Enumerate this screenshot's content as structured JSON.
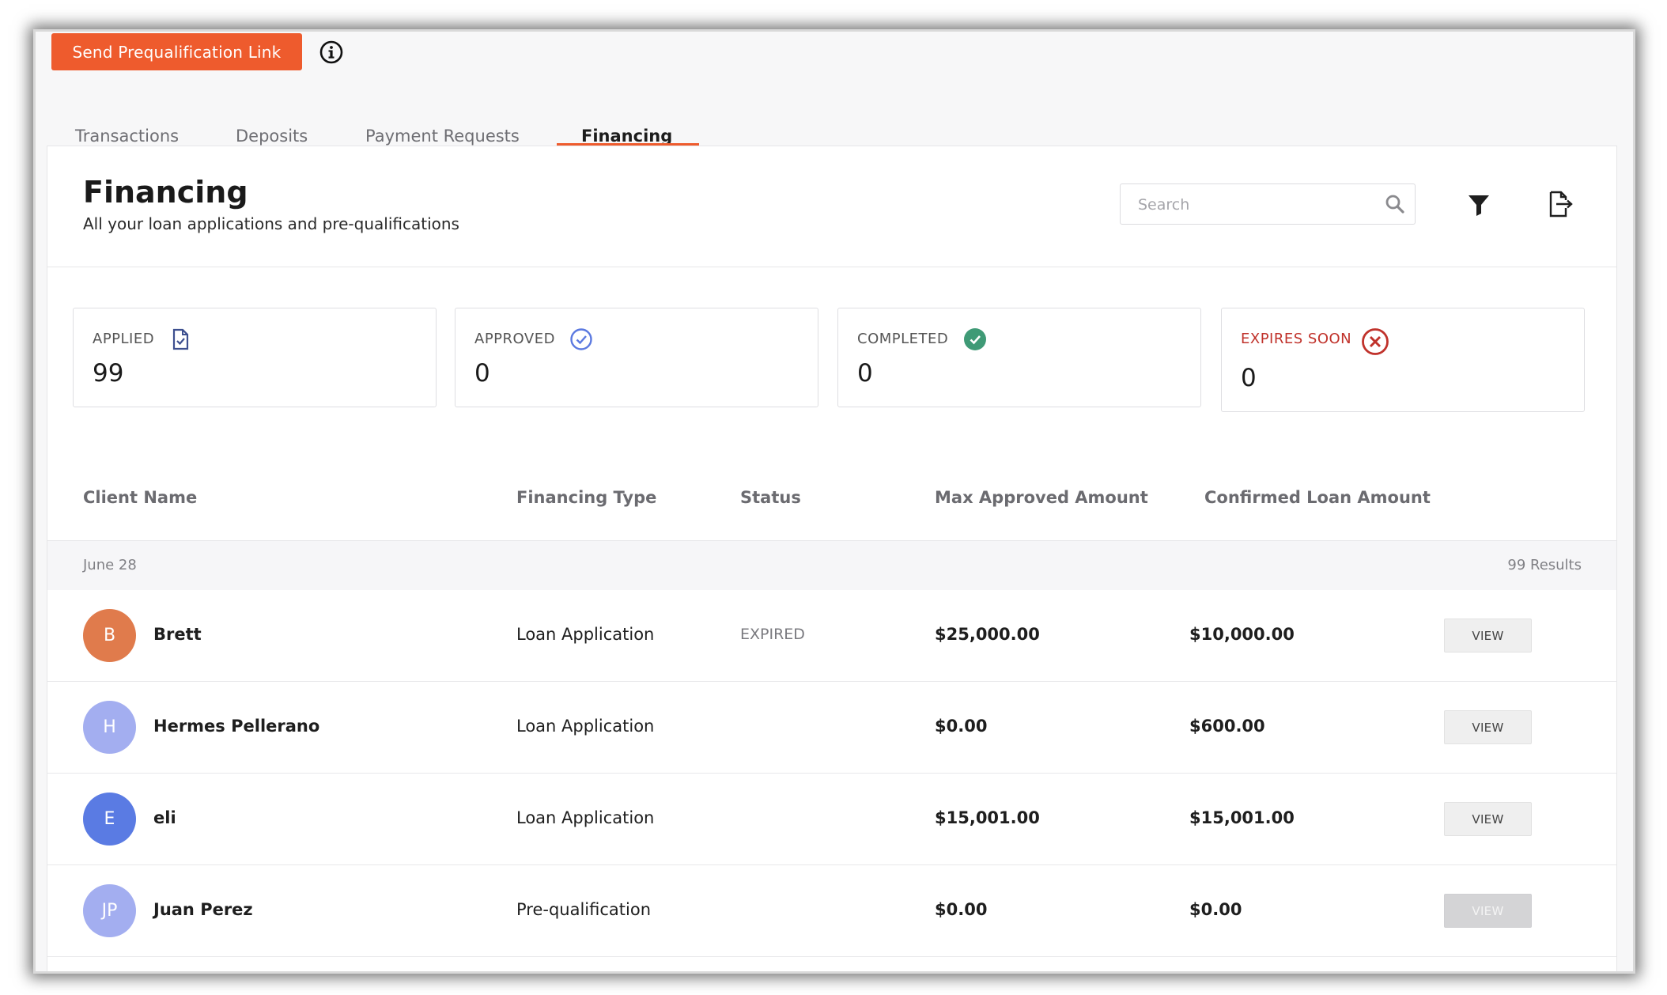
{
  "toolbar": {
    "prequal_button": "Send Prequalification Link",
    "info_icon": "info-icon"
  },
  "tabs": [
    {
      "label": "Transactions",
      "active": false
    },
    {
      "label": "Deposits",
      "active": false
    },
    {
      "label": "Payment Requests",
      "active": false
    },
    {
      "label": "Financing",
      "active": true
    }
  ],
  "header": {
    "title": "Financing",
    "subtitle": "All your loan applications and pre-qualifications",
    "search_placeholder": "Search",
    "search_value": ""
  },
  "icons": {
    "search": "search-icon",
    "filter": "filter-icon",
    "export": "export-icon"
  },
  "stats": [
    {
      "label": "APPLIED",
      "value": "99",
      "icon": "document-check-icon",
      "label_color": "#555555",
      "icon_color": "#3d4f8f"
    },
    {
      "label": "APPROVED",
      "value": "0",
      "icon": "circle-check-outline-icon",
      "label_color": "#555555",
      "icon_color": "#5b79e0"
    },
    {
      "label": "COMPLETED",
      "value": "0",
      "icon": "circle-check-filled-icon",
      "label_color": "#555555",
      "icon_color": "#3f9a76"
    },
    {
      "label": "EXPIRES SOON",
      "value": "0",
      "icon": "circle-x-icon",
      "label_color": "#c0322b",
      "icon_color": "#c0322b"
    }
  ],
  "table": {
    "columns": [
      "Client Name",
      "Financing Type",
      "Status",
      "Max Approved Amount",
      "Confirmed Loan Amount"
    ],
    "group": {
      "date": "June 28",
      "count": "99 Results"
    },
    "rows": [
      {
        "initials": "B",
        "avatar_color": "#e07b4c",
        "name": "Brett",
        "type": "Loan Application",
        "status": "EXPIRED",
        "max": "$25,000.00",
        "confirmed": "$10,000.00",
        "action": "VIEW",
        "action_enabled": true
      },
      {
        "initials": "H",
        "avatar_color": "#a3aef0",
        "name": "Hermes Pellerano",
        "type": "Loan Application",
        "status": "",
        "max": "$0.00",
        "confirmed": "$600.00",
        "action": "VIEW",
        "action_enabled": true
      },
      {
        "initials": "E",
        "avatar_color": "#5a7be3",
        "name": "eli",
        "type": "Loan Application",
        "status": "",
        "max": "$15,001.00",
        "confirmed": "$15,001.00",
        "action": "VIEW",
        "action_enabled": true
      },
      {
        "initials": "JP",
        "avatar_color": "#a3aef0",
        "name": "Juan Perez",
        "type": "Pre-qualification",
        "status": "",
        "max": "$0.00",
        "confirmed": "$0.00",
        "action": "VIEW",
        "action_enabled": false
      }
    ]
  },
  "colors": {
    "accent": "#ee5b2d"
  }
}
